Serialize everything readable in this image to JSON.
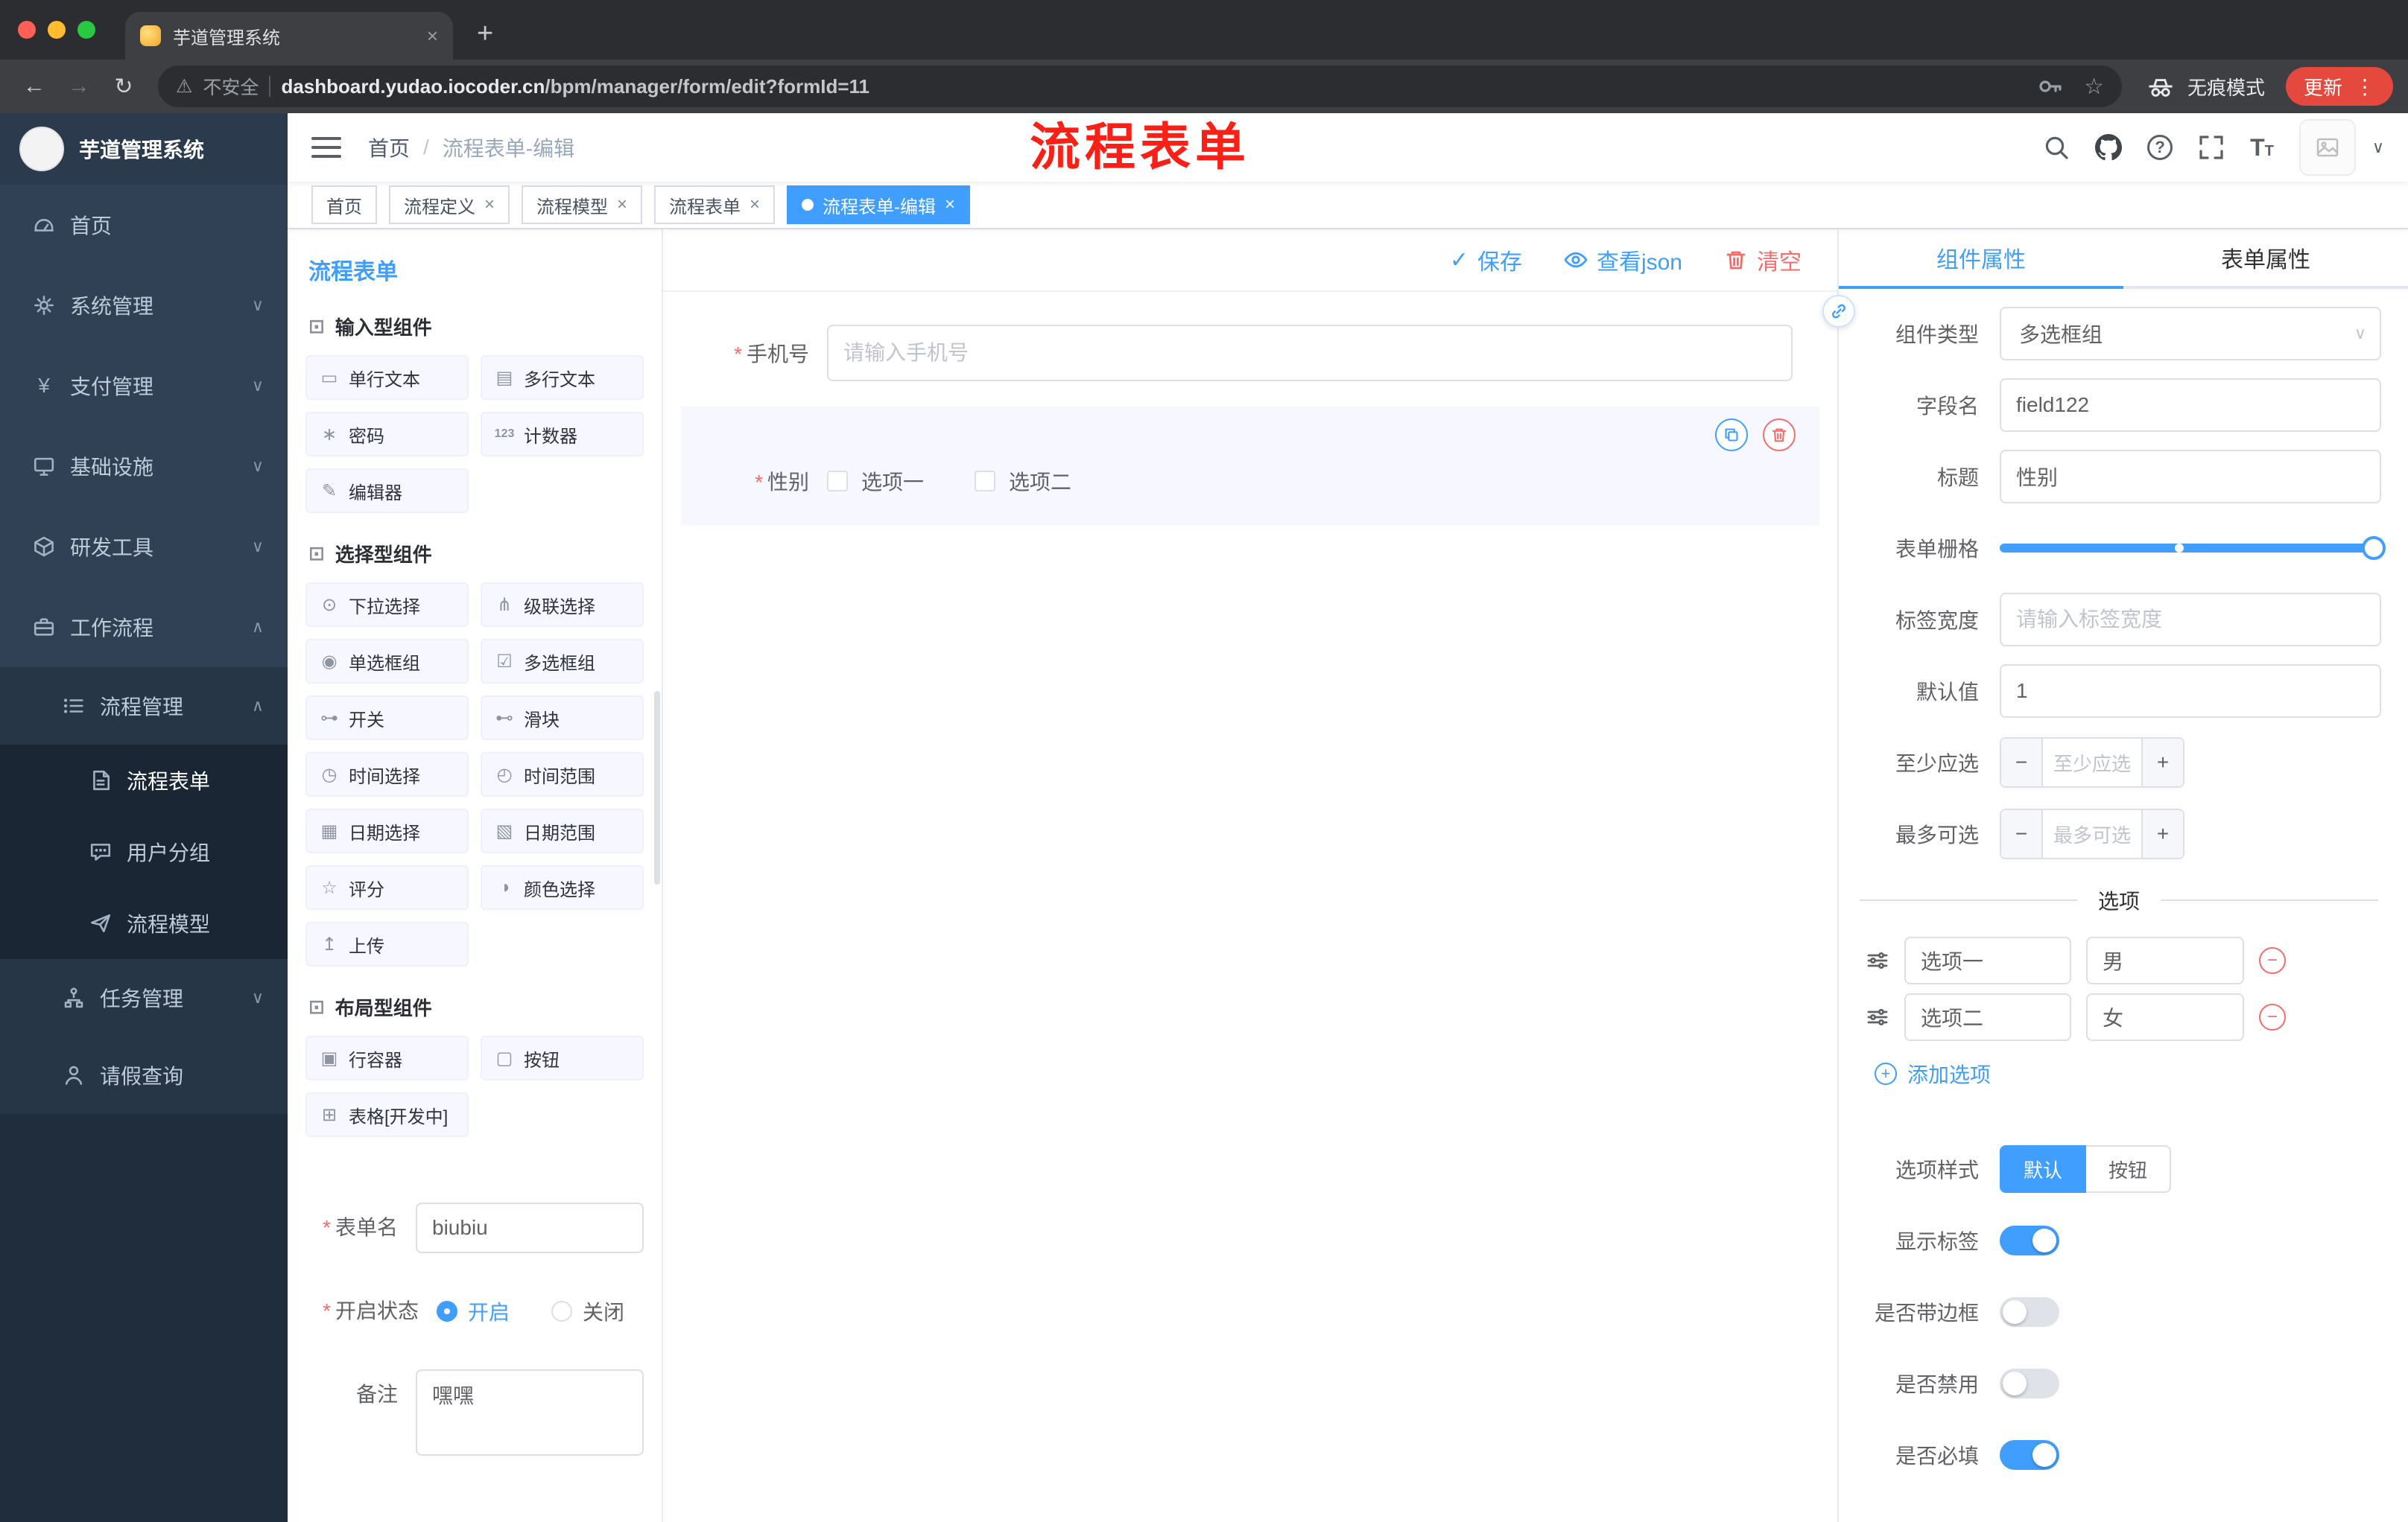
{
  "colors": {
    "accent": "#409eff",
    "danger": "#f56c6c",
    "annotation_red": "#fb2016",
    "sidebar_bg": "#304156",
    "sidebar_sub_bg": "#1f2d3d",
    "active_tag_bg": "#409eff"
  },
  "glyphs": {
    "back": "←",
    "forward": "→",
    "reload": "↻",
    "warning": "⚠",
    "star": "☆",
    "menu_dots": "⋮",
    "plus": "+",
    "close": "×",
    "check": "✓",
    "caret_down": "∨",
    "caret_up": "∧",
    "minus": "−",
    "asterisk": "*",
    "slash": "/",
    "question": "?",
    "tsize_big": "T",
    "tsize_small": "T"
  },
  "browser": {
    "tab_title": "芋道管理系统",
    "security_label": "不安全",
    "url_domain": "dashboard.yudao.iocoder.cn",
    "url_path": "/bpm/manager/form/edit?formId=11",
    "incognito_label": "无痕模式",
    "update_label": "更新"
  },
  "sidebar": {
    "logo_title": "芋道管理系统",
    "items": [
      {
        "label": "首页",
        "icon": "dashboard-icon"
      },
      {
        "label": "系统管理",
        "icon": "gear-icon"
      },
      {
        "label": "支付管理",
        "icon": "yen-icon"
      },
      {
        "label": "基础设施",
        "icon": "monitor-icon"
      },
      {
        "label": "研发工具",
        "icon": "cube-icon"
      },
      {
        "label": "工作流程",
        "icon": "briefcase-icon"
      },
      {
        "label": "流程管理",
        "icon": "list-icon"
      },
      {
        "label": "流程表单",
        "icon": "document-icon"
      },
      {
        "label": "用户分组",
        "icon": "chat-icon"
      },
      {
        "label": "流程模型",
        "icon": "send-icon"
      },
      {
        "label": "任务管理",
        "icon": "tree-icon"
      },
      {
        "label": "请假查询",
        "icon": "person-icon"
      }
    ]
  },
  "header": {
    "breadcrumb_home": "首页",
    "breadcrumb_current": "流程表单-编辑",
    "annotation": "流程表单"
  },
  "tags": {
    "items": [
      {
        "label": "首页",
        "active": false,
        "closable": false
      },
      {
        "label": "流程定义",
        "active": false,
        "closable": true
      },
      {
        "label": "流程模型",
        "active": false,
        "closable": true
      },
      {
        "label": "流程表单",
        "active": false,
        "closable": true
      },
      {
        "label": "流程表单-编辑",
        "active": true,
        "closable": true
      }
    ]
  },
  "designer": {
    "title": "流程表单",
    "actions": {
      "save": "保存",
      "view_json": "查看json",
      "clear": "清空"
    },
    "groups": [
      {
        "title": "输入型组件",
        "items": [
          {
            "icon": "single-line-icon",
            "glyph": "▭",
            "label": "单行文本"
          },
          {
            "icon": "textarea-icon",
            "glyph": "▤",
            "label": "多行文本"
          },
          {
            "icon": "password-icon",
            "glyph": "∗",
            "label": "密码"
          },
          {
            "icon": "counter-icon",
            "glyph": "123",
            "label": "计数器"
          },
          {
            "icon": "editor-icon",
            "glyph": "✎",
            "label": "编辑器"
          }
        ]
      },
      {
        "title": "选择型组件",
        "items": [
          {
            "icon": "select-icon",
            "glyph": "⊙",
            "label": "下拉选择"
          },
          {
            "icon": "cascader-icon",
            "glyph": "⋔",
            "label": "级联选择"
          },
          {
            "icon": "radio-group-icon",
            "glyph": "◉",
            "label": "单选框组"
          },
          {
            "icon": "checkbox-group-icon",
            "glyph": "☑",
            "label": "多选框组"
          },
          {
            "icon": "switch-icon",
            "glyph": "⊶",
            "label": "开关"
          },
          {
            "icon": "slider-icon",
            "glyph": "⊷",
            "label": "滑块"
          },
          {
            "icon": "time-icon",
            "glyph": "◷",
            "label": "时间选择"
          },
          {
            "icon": "time-range-icon",
            "glyph": "◴",
            "label": "时间范围"
          },
          {
            "icon": "date-icon",
            "glyph": "▦",
            "label": "日期选择"
          },
          {
            "icon": "date-range-icon",
            "glyph": "▧",
            "label": "日期范围"
          },
          {
            "icon": "rate-icon",
            "glyph": "☆",
            "label": "评分"
          },
          {
            "icon": "color-icon",
            "glyph": "◑",
            "label": "颜色选择"
          },
          {
            "icon": "upload-icon",
            "glyph": "↥",
            "label": "上传"
          }
        ]
      },
      {
        "title": "布局型组件",
        "items": [
          {
            "icon": "row-container-icon",
            "glyph": "▣",
            "label": "行容器"
          },
          {
            "icon": "button-icon",
            "glyph": "▢",
            "label": "按钮"
          },
          {
            "icon": "table-icon",
            "glyph": "⊞",
            "label": "表格[开发中]"
          }
        ]
      }
    ],
    "settings": {
      "name_label": "表单名",
      "name_value": "biubiu",
      "status_label": "开启状态",
      "status_on": "开启",
      "status_off": "关闭",
      "remark_label": "备注",
      "remark_value": "嘿嘿"
    }
  },
  "canvas": {
    "phone": {
      "label": "手机号",
      "placeholder": "请输入手机号"
    },
    "gender": {
      "label": "性别",
      "option1": "选项一",
      "option2": "选项二"
    }
  },
  "inspector": {
    "tab_component": "组件属性",
    "tab_form": "表单属性",
    "component_type_label": "组件类型",
    "component_type_value": "多选框组",
    "field_name_label": "字段名",
    "field_name_value": "field122",
    "title_label": "标题",
    "title_value": "性别",
    "grid_label": "表单栅格",
    "label_width_label": "标签宽度",
    "label_width_placeholder": "请输入标签宽度",
    "default_label": "默认值",
    "default_value": "1",
    "min_label": "至少应选",
    "min_placeholder": "至少应选",
    "max_label": "最多可选",
    "max_placeholder": "最多可选",
    "options_title": "选项",
    "option_rows": [
      {
        "label": "选项一",
        "value": "男"
      },
      {
        "label": "选项二",
        "value": "女"
      }
    ],
    "add_option": "添加选项",
    "style_label": "选项样式",
    "style_default": "默认",
    "style_button": "按钮",
    "switch_show_label": "显示标签",
    "switch_border": "是否带边框",
    "switch_disabled": "是否禁用",
    "switch_required": "是否必填"
  }
}
